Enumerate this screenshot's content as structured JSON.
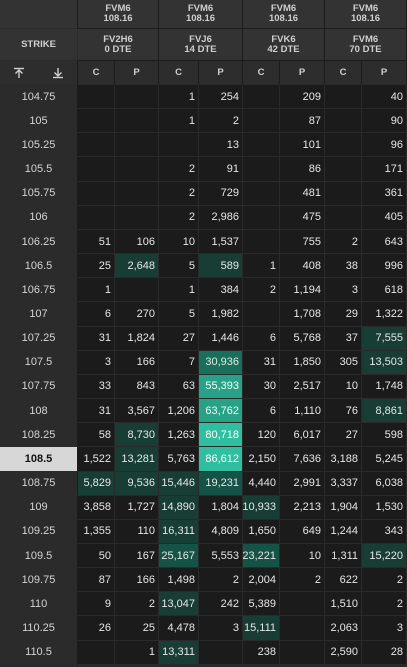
{
  "header": {
    "groups": [
      {
        "future": "FVM6",
        "price": "108.16",
        "option": "FV2H6",
        "dte": "0 DTE"
      },
      {
        "future": "FVM6",
        "price": "108.16",
        "option": "FVJ6",
        "dte": "14 DTE"
      },
      {
        "future": "FVM6",
        "price": "108.16",
        "option": "FVK6",
        "dte": "42 DTE"
      },
      {
        "future": "FVM6",
        "price": "108.16",
        "option": "FVM6",
        "dte": "70 DTE"
      }
    ],
    "strike_label": "STRIKE",
    "call_label": "C",
    "put_label": "P",
    "sort_icons": [
      "pin-top-icon",
      "pin-bottom-icon"
    ]
  },
  "selected_strike": "108.5",
  "heat_colors": {
    "h1": "#173d35",
    "h2": "#145345",
    "h3": "#18705c",
    "h4": "#27a286",
    "h5": "#2fbfa0"
  },
  "rows": [
    {
      "strike": "104.75",
      "v": [
        "",
        "",
        "1",
        "254",
        "",
        "209",
        "",
        "40"
      ]
    },
    {
      "strike": "105",
      "v": [
        "",
        "",
        "1",
        "2",
        "",
        "87",
        "",
        "90"
      ]
    },
    {
      "strike": "105.25",
      "v": [
        "",
        "",
        "",
        "13",
        "",
        "101",
        "",
        "96"
      ]
    },
    {
      "strike": "105.5",
      "v": [
        "",
        "",
        "2",
        "91",
        "",
        "86",
        "",
        "171"
      ]
    },
    {
      "strike": "105.75",
      "v": [
        "",
        "",
        "2",
        "729",
        "",
        "481",
        "",
        "361"
      ]
    },
    {
      "strike": "106",
      "v": [
        "",
        "",
        "2",
        "2,986",
        "",
        "475",
        "",
        "405"
      ]
    },
    {
      "strike": "106.25",
      "v": [
        "51",
        "106",
        "10",
        "1,537",
        "",
        "755",
        "2",
        "643"
      ]
    },
    {
      "strike": "106.5",
      "v": [
        "25",
        "2,648",
        "5",
        "589",
        "1",
        "408",
        "38",
        "996"
      ]
    },
    {
      "strike": "106.75",
      "v": [
        "1",
        "",
        "1",
        "384",
        "2",
        "1,194",
        "3",
        "618"
      ]
    },
    {
      "strike": "107",
      "v": [
        "6",
        "270",
        "5",
        "1,982",
        "",
        "1,708",
        "29",
        "1,322"
      ]
    },
    {
      "strike": "107.25",
      "v": [
        "31",
        "1,824",
        "27",
        "1,446",
        "6",
        "5,768",
        "37",
        "7,555"
      ]
    },
    {
      "strike": "107.5",
      "v": [
        "3",
        "166",
        "7",
        "30,936",
        "31",
        "1,850",
        "305",
        "13,503"
      ]
    },
    {
      "strike": "107.75",
      "v": [
        "33",
        "843",
        "63",
        "55,393",
        "30",
        "2,517",
        "10",
        "1,748"
      ]
    },
    {
      "strike": "108",
      "v": [
        "31",
        "3,567",
        "1,206",
        "63,762",
        "6",
        "1,110",
        "76",
        "8,861"
      ]
    },
    {
      "strike": "108.25",
      "v": [
        "58",
        "8,730",
        "1,263",
        "80,718",
        "120",
        "6,017",
        "27",
        "598"
      ]
    },
    {
      "strike": "108.5",
      "v": [
        "1,522",
        "13,281",
        "5,763",
        "86,612",
        "2,150",
        "7,636",
        "3,188",
        "5,245"
      ]
    },
    {
      "strike": "108.75",
      "v": [
        "5,829",
        "9,536",
        "15,446",
        "19,231",
        "4,440",
        "2,991",
        "3,337",
        "6,038"
      ]
    },
    {
      "strike": "109",
      "v": [
        "3,858",
        "1,727",
        "14,890",
        "1,804",
        "10,933",
        "2,213",
        "1,904",
        "1,530"
      ]
    },
    {
      "strike": "109.25",
      "v": [
        "1,355",
        "110",
        "16,311",
        "4,809",
        "1,650",
        "649",
        "1,244",
        "343"
      ]
    },
    {
      "strike": "109.5",
      "v": [
        "50",
        "167",
        "25,167",
        "5,553",
        "23,221",
        "10",
        "1,311",
        "15,220"
      ]
    },
    {
      "strike": "109.75",
      "v": [
        "87",
        "166",
        "1,498",
        "2",
        "2,004",
        "2",
        "622",
        "2"
      ]
    },
    {
      "strike": "110",
      "v": [
        "9",
        "2",
        "13,047",
        "242",
        "5,389",
        "",
        "1,510",
        "2"
      ]
    },
    {
      "strike": "110.25",
      "v": [
        "26",
        "25",
        "4,478",
        "3",
        "15,111",
        "",
        "2,063",
        "3"
      ]
    },
    {
      "strike": "110.5",
      "v": [
        "",
        "1",
        "13,311",
        "",
        "238",
        "",
        "2,590",
        "28"
      ]
    },
    {
      "strike": "110.75",
      "v": [
        "70",
        "26",
        "68",
        "1",
        "313",
        "",
        "709",
        "2"
      ]
    },
    {
      "strike": "111",
      "v": [
        "",
        "",
        "4",
        "3",
        "3,400",
        "",
        "397",
        ""
      ]
    }
  ],
  "heat": {
    "7": {
      "1": "h1",
      "3": "h1"
    },
    "10": {
      "7": "h1"
    },
    "11": {
      "3": "h3",
      "7": "h1"
    },
    "12": {
      "3": "h4"
    },
    "13": {
      "3": "h4",
      "7": "h1"
    },
    "14": {
      "1": "h1",
      "3": "h5"
    },
    "15": {
      "1": "h1",
      "3": "h5"
    },
    "16": {
      "0": "h1",
      "1": "h1",
      "2": "h1",
      "3": "h2"
    },
    "17": {
      "2": "h1",
      "4": "h1"
    },
    "18": {
      "2": "h1"
    },
    "19": {
      "2": "h2",
      "4": "h2",
      "7": "h1"
    },
    "21": {
      "2": "h1"
    },
    "22": {
      "4": "h1"
    },
    "23": {
      "2": "h1"
    }
  }
}
